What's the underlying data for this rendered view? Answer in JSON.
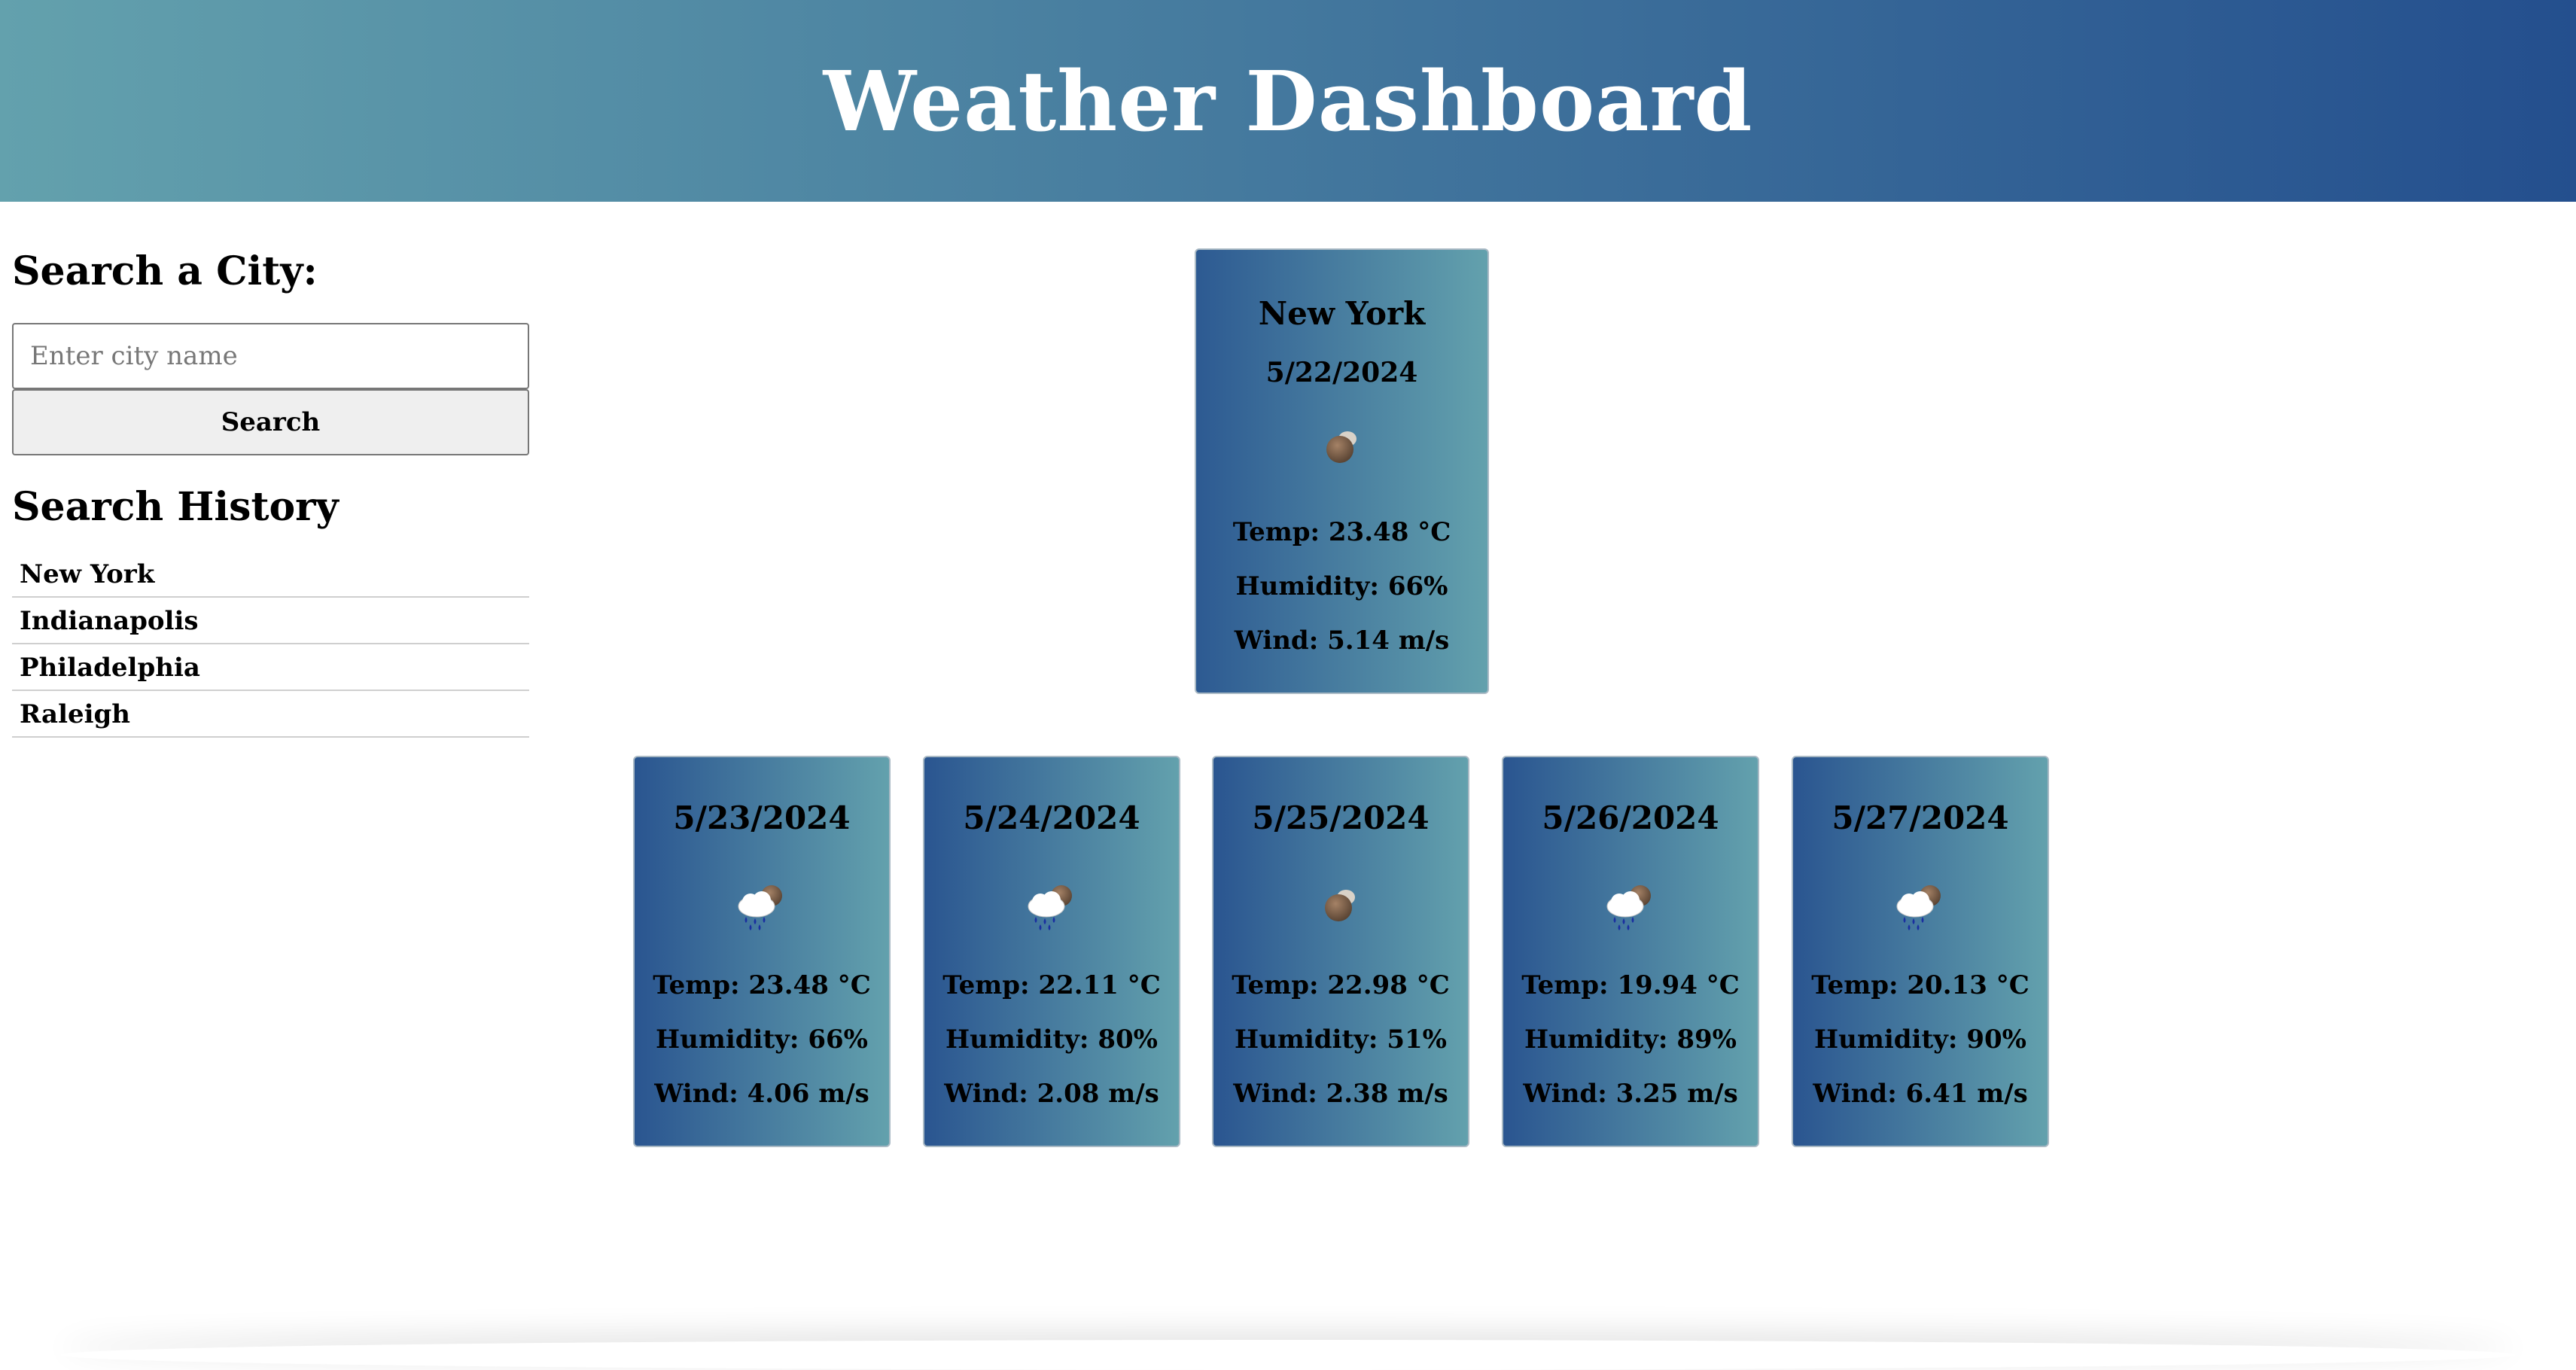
{
  "header": {
    "title": "Weather Dashboard"
  },
  "sidebar": {
    "search_label": "Search a City:",
    "search_placeholder": "Enter city name",
    "search_button": "Search",
    "history_title": "Search History",
    "history": [
      "New York",
      "Indianapolis",
      "Philadelphia",
      "Raleigh"
    ]
  },
  "current": {
    "city": "New York",
    "date": "5/22/2024",
    "icon": "clouds-icon",
    "temp": "Temp: 23.48 °C",
    "humidity": "Humidity: 66%",
    "wind": "Wind: 5.14 m/s"
  },
  "forecast": [
    {
      "date": "5/23/2024",
      "icon": "rain-clouds-icon",
      "temp": "Temp: 23.48 °C",
      "humidity": "Humidity: 66%",
      "wind": "Wind: 4.06 m/s"
    },
    {
      "date": "5/24/2024",
      "icon": "rain-clouds-icon",
      "temp": "Temp: 22.11 °C",
      "humidity": "Humidity: 80%",
      "wind": "Wind: 2.08 m/s"
    },
    {
      "date": "5/25/2024",
      "icon": "clouds-icon",
      "temp": "Temp: 22.98 °C",
      "humidity": "Humidity: 51%",
      "wind": "Wind: 2.38 m/s"
    },
    {
      "date": "5/26/2024",
      "icon": "rain-clouds-icon",
      "temp": "Temp: 19.94 °C",
      "humidity": "Humidity: 89%",
      "wind": "Wind: 3.25 m/s"
    },
    {
      "date": "5/27/2024",
      "icon": "rain-clouds-icon",
      "temp": "Temp: 20.13 °C",
      "humidity": "Humidity: 90%",
      "wind": "Wind: 6.41 m/s"
    }
  ]
}
